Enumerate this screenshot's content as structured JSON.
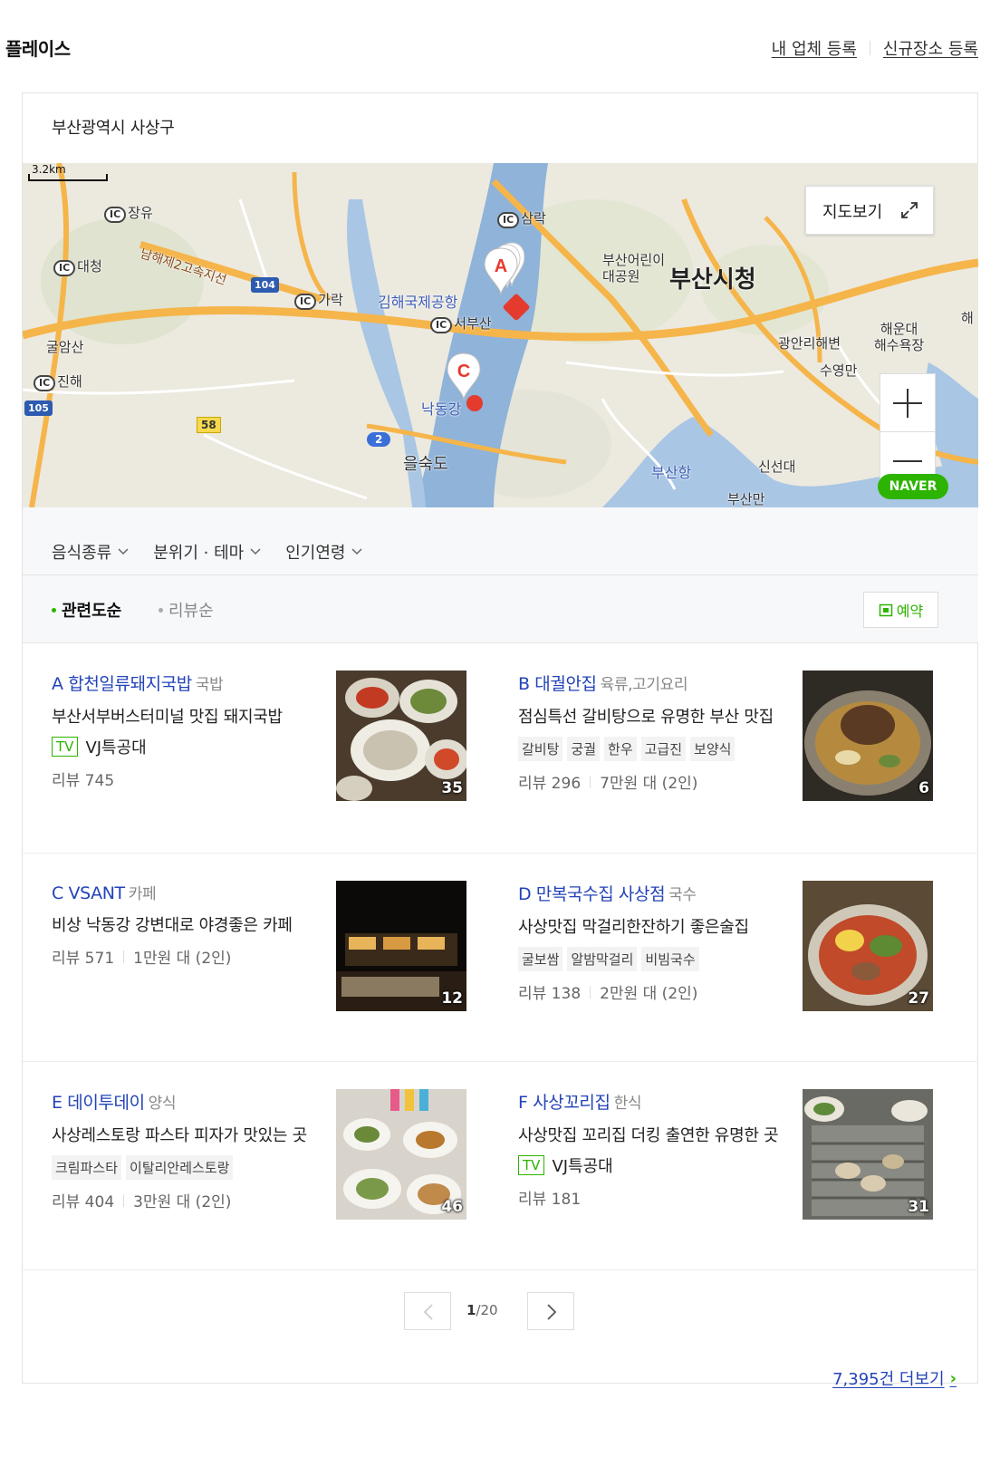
{
  "header": {
    "title": "플레이스",
    "links": [
      "내 업체 등록",
      "신규장소 등록"
    ]
  },
  "location": "부산광역시 사상구",
  "map": {
    "scale": "3.2km",
    "view_button": "지도보기",
    "logo": "NAVER",
    "labels": {
      "jangyu": "장유",
      "daecheong": "대청",
      "gulamsan": "굴암산",
      "jinhae": "진해",
      "namhae": "남해제2고속지선",
      "garak": "가락",
      "airport": "김해국제공항",
      "seobusan": "서부산",
      "samrak": "삼락",
      "children_park": "부산어린이\n대공원",
      "cityhall": "부산시청",
      "gwangalli": "광안리해변",
      "suyeongman": "수영만",
      "haeundae": "해운대\n해수욕장",
      "hae": "해",
      "nakdong": "낙동강",
      "eulsukdo": "을숙도",
      "busanhang": "부산항",
      "sinseondae": "신선대",
      "busanman": "부산만"
    },
    "ic_badge": "IC",
    "shields": {
      "r104": "104",
      "r105": "105",
      "r58": "58",
      "r2": "2"
    },
    "pins": [
      "A",
      "C"
    ]
  },
  "filters": [
    "음식종류",
    "분위기 · 테마",
    "인기연령"
  ],
  "sort": {
    "options": [
      "관련도순",
      "리뷰순"
    ],
    "reserve": "예약"
  },
  "places": [
    {
      "letter": "A",
      "name": "합천일류돼지국밥",
      "category": "국밥",
      "desc": "부산서부버스터미널 맛집 돼지국밥",
      "tv": "VJ특공대",
      "tv_badge": "TV",
      "tags": [],
      "review": "리뷰 745",
      "price": "",
      "photos": "35"
    },
    {
      "letter": "B",
      "name": "대궐안집",
      "category": "육류,고기요리",
      "desc": "점심특선 갈비탕으로 유명한 부산 맛집",
      "tv": "",
      "tv_badge": "",
      "tags": [
        "갈비탕",
        "궁궐",
        "한우",
        "고급진",
        "보양식"
      ],
      "review": "리뷰 296",
      "price": "7만원 대 (2인)",
      "photos": "6"
    },
    {
      "letter": "C",
      "name": "VSANT",
      "category": "카페",
      "desc": "비상 낙동강 강변대로 야경좋은 카페",
      "tv": "",
      "tv_badge": "",
      "tags": [],
      "review": "리뷰 571",
      "price": "1만원 대 (2인)",
      "photos": "12"
    },
    {
      "letter": "D",
      "name": "만복국수집 사상점",
      "category": "국수",
      "desc": "사상맛집 막걸리한잔하기 좋은술집",
      "tv": "",
      "tv_badge": "",
      "tags": [
        "굴보쌈",
        "알밤막걸리",
        "비빔국수"
      ],
      "review": "리뷰 138",
      "price": "2만원 대 (2인)",
      "photos": "27"
    },
    {
      "letter": "E",
      "name": "데이투데이",
      "category": "양식",
      "desc": "사상레스토랑 파스타 피자가 맛있는 곳",
      "tv": "",
      "tv_badge": "",
      "tags": [
        "크림파스타",
        "이탈리안레스토랑"
      ],
      "review": "리뷰 404",
      "price": "3만원 대 (2인)",
      "photos": "46"
    },
    {
      "letter": "F",
      "name": "사상꼬리집",
      "category": "한식",
      "desc": "사상맛집 꼬리집 더킹 출연한 유명한 곳",
      "tv": "VJ특공대",
      "tv_badge": "TV",
      "tags": [],
      "review": "리뷰 181",
      "price": "",
      "photos": "31"
    }
  ],
  "pagination": {
    "current": "1",
    "total": "/20"
  },
  "more": "7,395건 더보기",
  "colors": {
    "accent_green": "#2db400",
    "link_blue": "#2343b8",
    "pin_red": "#e53a2e"
  }
}
